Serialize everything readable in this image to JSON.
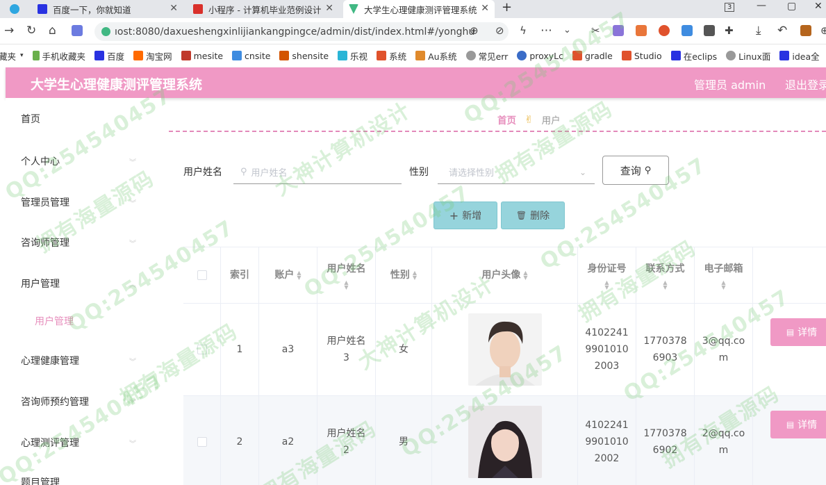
{
  "browser": {
    "tabs": [
      {
        "title": "百度一下，你就知道",
        "icon_color": "#2932e1"
      },
      {
        "title": "小程序 - 计算机毕业范例设计",
        "icon_color": "#d9302b"
      },
      {
        "title": "大学生心理健康测评管理系统",
        "icon_color": "#41b883"
      }
    ],
    "url": "ıost:8080/daxueshengxinlijiankangpingce/admin/dist/index.html#/yonghu",
    "bookmarks": [
      "藏夹",
      "手机收藏夹",
      "百度",
      "淘宝网",
      "mesite",
      "cnsite",
      "shensite",
      "乐视",
      "系统",
      "Au系统",
      "常见err",
      "proxyLc",
      "gradle",
      "Studio",
      "在eclips",
      "Linux面",
      "idea全"
    ]
  },
  "app": {
    "title": "大学生心理健康测评管理系统",
    "admin_label": "管理员 admin",
    "logout_label": "退出登录",
    "accent": "#f099c5"
  },
  "sidebar": {
    "items": [
      {
        "label": "首页"
      },
      {
        "label": "个人中心"
      },
      {
        "label": "管理员管理"
      },
      {
        "label": "咨询师管理"
      },
      {
        "label": "用户管理"
      },
      {
        "label": "心理健康管理"
      },
      {
        "label": "咨询师预约管理"
      },
      {
        "label": "心理测评管理"
      },
      {
        "label": "题目管理"
      }
    ],
    "active_sub": "用户管理"
  },
  "breadcrumb": {
    "home": "首页",
    "sep": "✌",
    "current": "用户"
  },
  "search": {
    "name_label": "用户姓名",
    "name_placeholder": "用户姓名",
    "gender_label": "性别",
    "gender_placeholder": "请选择性别",
    "query_label": "查询",
    "add_label": "新增",
    "delete_label": "删除"
  },
  "table": {
    "headers": [
      "索引",
      "账户",
      "用户姓名",
      "性别",
      "用户头像",
      "身份证号",
      "联系方式",
      "电子邮箱"
    ],
    "rows": [
      {
        "index": "1",
        "account": "a3",
        "name": "用户姓名3",
        "gender": "女",
        "id_card": "410224199010102003",
        "phone": "17703786903",
        "email": "3@qq.com",
        "detail": "详情"
      },
      {
        "index": "2",
        "account": "a2",
        "name": "用户姓名2",
        "gender": "男",
        "id_card": "410224199010102002",
        "phone": "17703786902",
        "email": "2@qq.com",
        "detail": "详情"
      }
    ]
  },
  "watermarks": [
    "QQ:254540457",
    "大神计算机设计",
    "拥有海量源码"
  ]
}
